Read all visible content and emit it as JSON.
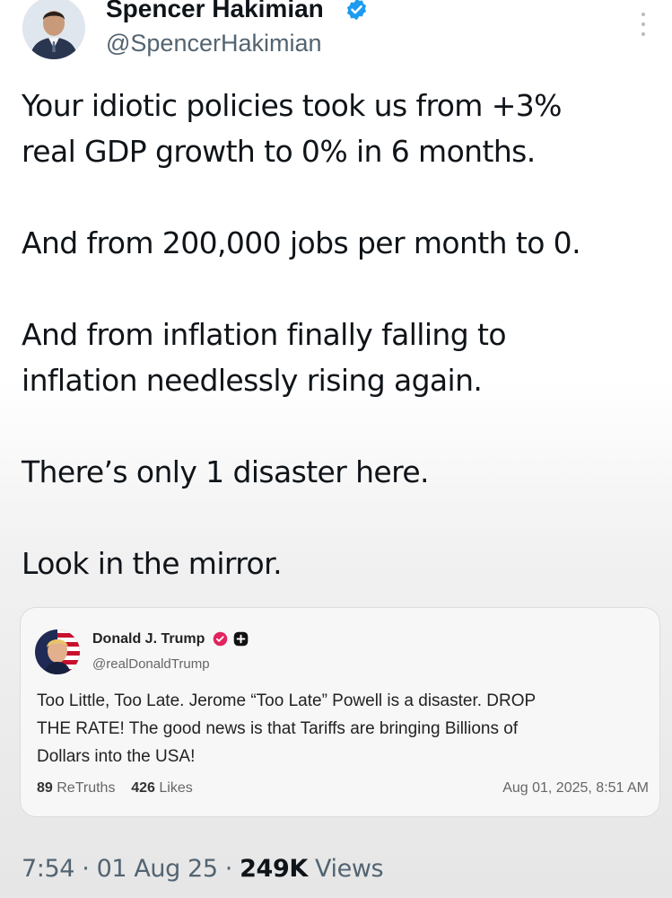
{
  "tweet": {
    "author_name": "Spencer Hakimian",
    "handle": "@SpencerHakimian",
    "paragraphs": [
      [
        "Your idiotic policies took us from +3%",
        "real GDP growth to 0% in 6 months."
      ],
      [
        "And from 200,000 jobs per month to 0."
      ],
      [
        "And from inflation finally falling to",
        "inflation needlessly rising again."
      ],
      [
        "There’s only 1 disaster here."
      ],
      [
        "Look in the mirror."
      ]
    ],
    "time": "7:54",
    "date": "01 Aug 25",
    "separator": "·",
    "views_count": "249K",
    "views_label": "Views"
  },
  "quoted_post": {
    "author_name": "Donald J. Trump",
    "handle": "@realDonaldTrump",
    "text_lines": [
      "Too Little, Too Late. Jerome “Too Late” Powell is a disaster. DROP",
      "THE RATE! The good news is that Tariffs are bringing Billions of",
      "Dollars into the USA!"
    ],
    "retruths_count": "89",
    "retruths_label": "ReTruths",
    "likes_count": "426",
    "likes_label": "Likes",
    "timestamp": "Aug 01, 2025, 8:51 AM"
  },
  "icons": {
    "verified": "verified-badge-icon",
    "more": "more-options-icon",
    "quote_verified": "verified-badge-icon",
    "quote_plus": "plus-badge-icon"
  },
  "colors": {
    "verified_blue": "#1d9bf0",
    "truth_verified_pink": "#e0245e",
    "text_primary": "#0f1419",
    "text_secondary": "#536471"
  }
}
